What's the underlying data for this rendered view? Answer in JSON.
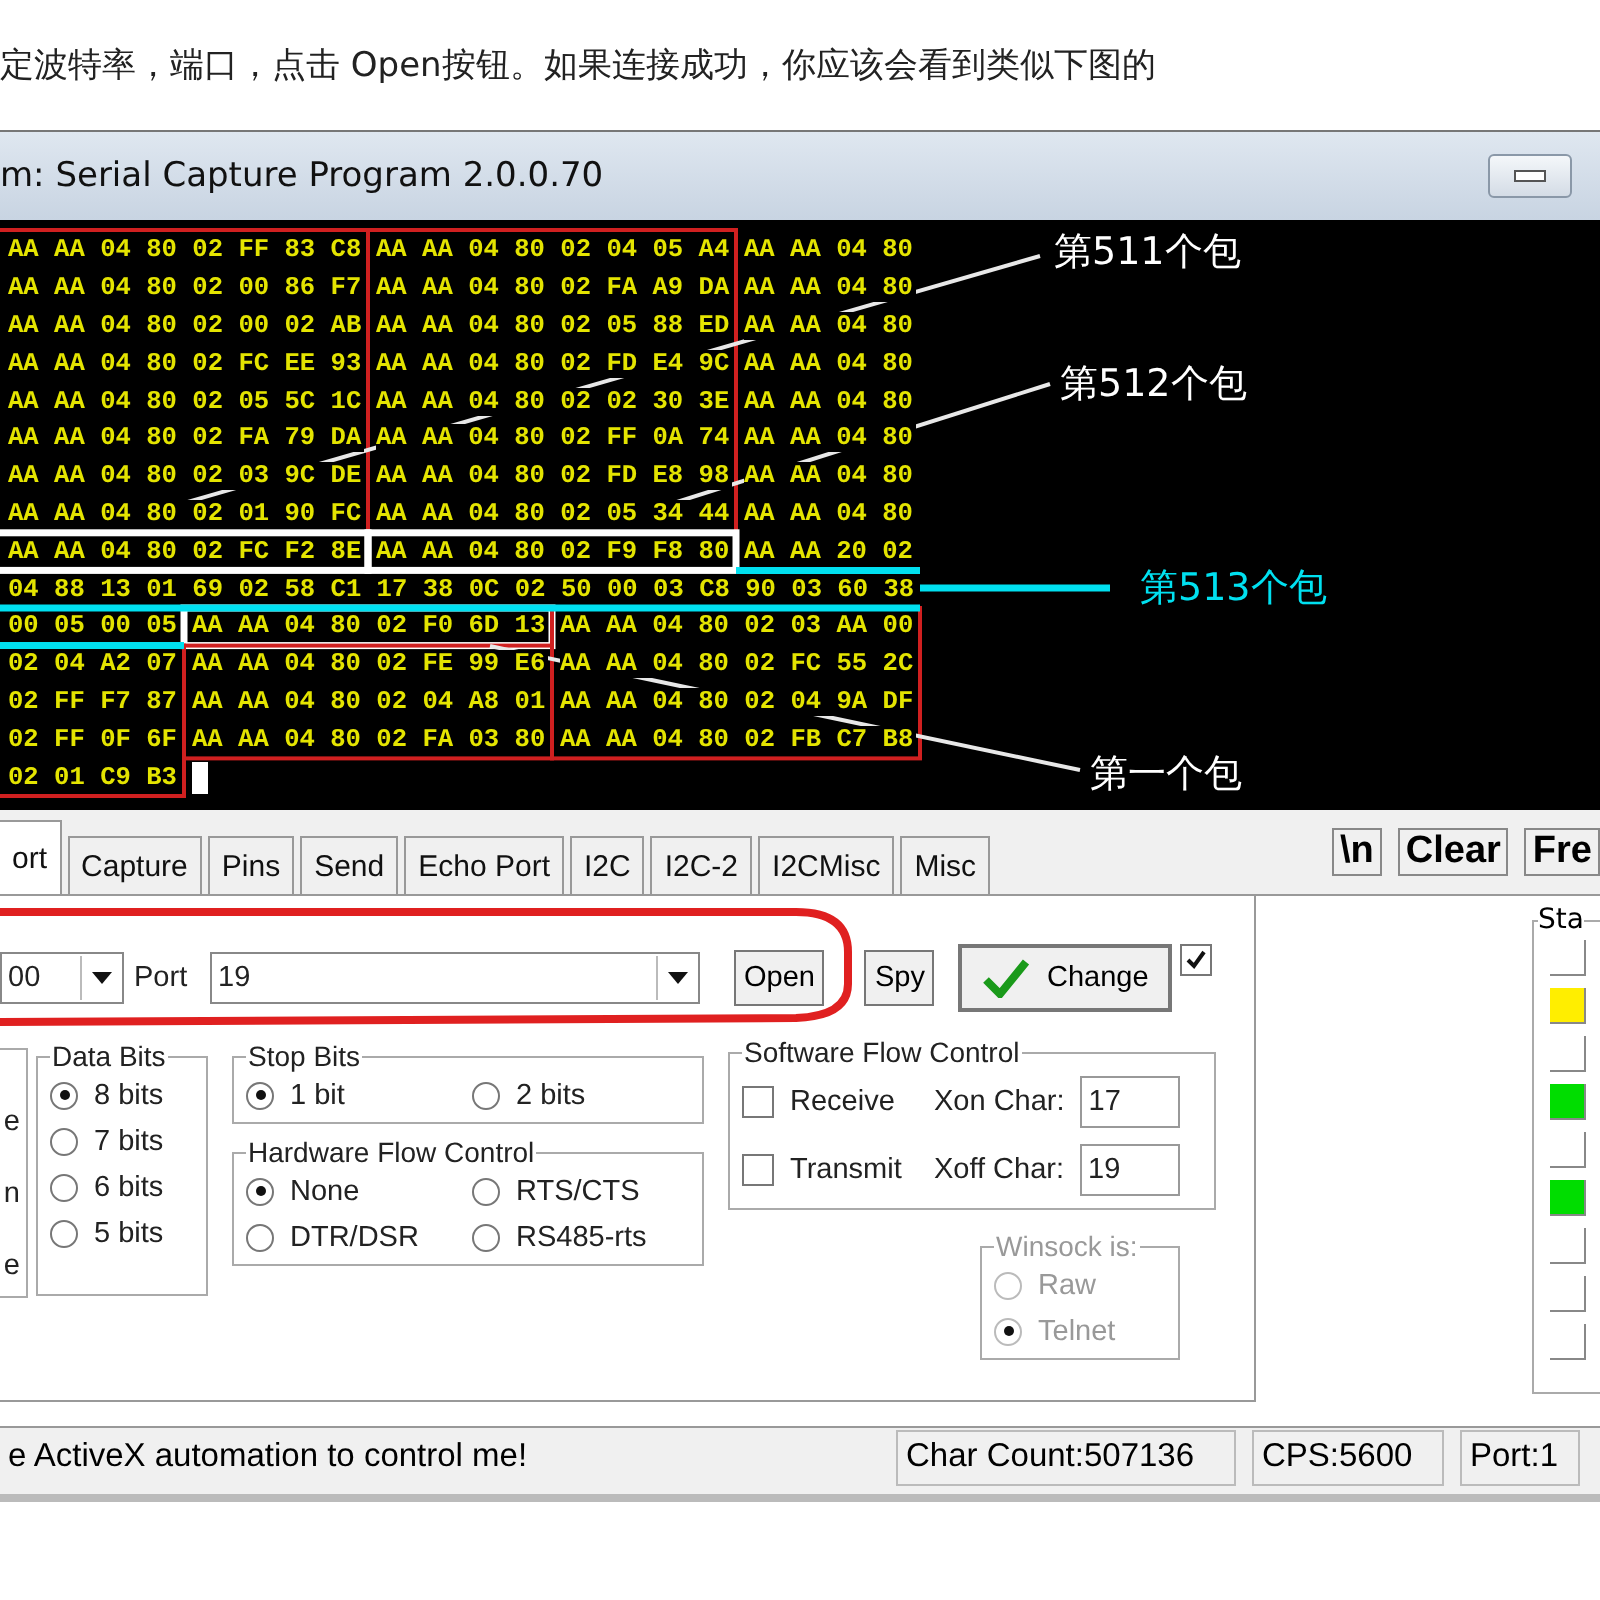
{
  "instruction": "定波特率，端口，点击 Open按钮。如果连接成功，你应该会看到类似下图的",
  "window": {
    "title": "m: Serial Capture Program 2.0.0.70"
  },
  "terminal": {
    "rows": [
      [
        "AA AA 04 80 02 FF 83 C8",
        "AA AA 04 80 02 04 05 A4",
        "AA AA 04 80"
      ],
      [
        "AA AA 04 80 02 00 86 F7",
        "AA AA 04 80 02 FA A9 DA",
        "AA AA 04 80"
      ],
      [
        "AA AA 04 80 02 00 02 AB",
        "AA AA 04 80 02 05 88 ED",
        "AA AA 04 80"
      ],
      [
        "AA AA 04 80 02 FC EE 93",
        "AA AA 04 80 02 FD E4 9C",
        "AA AA 04 80"
      ],
      [
        "AA AA 04 80 02 05 5C 1C",
        "AA AA 04 80 02 02 30 3E",
        "AA AA 04 80"
      ],
      [
        "AA AA 04 80 02 FA 79 DA",
        "AA AA 04 80 02 FF 0A 74",
        "AA AA 04 80"
      ],
      [
        "AA AA 04 80 02 03 9C DE",
        "AA AA 04 80 02 FD E8 98",
        "AA AA 04 80"
      ],
      [
        "AA AA 04 80 02 01 90 FC",
        "AA AA 04 80 02 05 34 44",
        "AA AA 04 80"
      ],
      [
        "AA AA 04 80 02 FC F2 8E",
        "AA AA 04 80 02 F9 F8 80",
        "AA AA 20 02"
      ],
      [
        "04 88 13 01 69 02 58 C1 17 38 0C 02 50 00 03 C8 90 03 60 38"
      ],
      [
        "00 05 00 05",
        "AA AA 04 80 02 F0 6D 13",
        "AA AA 04 80 02 03 AA 00"
      ],
      [
        "02 04 A2 07",
        "AA AA 04 80 02 FE 99 E6",
        "AA AA 04 80 02 FC 55 2C"
      ],
      [
        "02 FF F7 87",
        "AA AA 04 80 02 04 A8 01",
        "AA AA 04 80 02 04 9A DF"
      ],
      [
        "02 FF 0F 6F",
        "AA AA 04 80 02 FA 03 80",
        "AA AA 04 80 02 FB C7 B8"
      ],
      [
        "02 01 C9 B3"
      ]
    ]
  },
  "annotations": [
    {
      "text": "第511个包",
      "color": "#ffffff"
    },
    {
      "text": "第512个包",
      "color": "#ffffff"
    },
    {
      "text": "第513个包",
      "color": "#00e0f0"
    },
    {
      "text": "第一个包",
      "color": "#ffffff"
    }
  ],
  "tabs": [
    {
      "label": "ort",
      "selected": true
    },
    {
      "label": "Capture",
      "selected": false
    },
    {
      "label": "Pins",
      "selected": false
    },
    {
      "label": "Send",
      "selected": false
    },
    {
      "label": "Echo Port",
      "selected": false
    },
    {
      "label": "I2C",
      "selected": false
    },
    {
      "label": "I2C-2",
      "selected": false
    },
    {
      "label": "I2CMisc",
      "selected": false
    },
    {
      "label": "Misc",
      "selected": false
    }
  ],
  "toolbar_buttons": [
    "\\n",
    "Clear",
    "Fre"
  ],
  "port_row": {
    "baud": "00",
    "port_label": "Port",
    "port": "19",
    "open": "Open",
    "spy": "Spy",
    "change": "Change",
    "checked": true
  },
  "left_group": {
    "options": [
      "e",
      "n",
      "e"
    ]
  },
  "data_bits": {
    "title": "Data Bits",
    "options": [
      {
        "label": "8 bits",
        "selected": true
      },
      {
        "label": "7 bits",
        "selected": false
      },
      {
        "label": "6 bits",
        "selected": false
      },
      {
        "label": "5 bits",
        "selected": false
      }
    ]
  },
  "stop_bits": {
    "title": "Stop Bits",
    "options": [
      {
        "label": "1 bit",
        "selected": true
      },
      {
        "label": "2 bits",
        "selected": false
      }
    ]
  },
  "hardware_flow": {
    "title": "Hardware Flow Control",
    "options": [
      {
        "label": "None",
        "selected": true
      },
      {
        "label": "RTS/CTS",
        "selected": false
      },
      {
        "label": "DTR/DSR",
        "selected": false
      },
      {
        "label": "RS485-rts",
        "selected": false
      }
    ]
  },
  "software_flow": {
    "title": "Software Flow Control",
    "rows": [
      {
        "label": "Receive",
        "checked": false,
        "char_label": "Xon Char:",
        "value": "17"
      },
      {
        "label": "Transmit",
        "checked": false,
        "char_label": "Xoff Char:",
        "value": "19"
      }
    ]
  },
  "winsock": {
    "title": "Winsock is:",
    "disabled": true,
    "options": [
      {
        "label": "Raw",
        "selected": false
      },
      {
        "label": "Telnet",
        "selected": true
      }
    ]
  },
  "status_panel": {
    "title": "Sta",
    "leds": [
      {
        "lit": false
      },
      {
        "lit": true,
        "color": "#ffee00"
      },
      {
        "lit": false
      },
      {
        "lit": true,
        "color": "#00dd00"
      },
      {
        "lit": false
      },
      {
        "lit": true,
        "color": "#00dd00"
      },
      {
        "lit": false
      },
      {
        "lit": false
      },
      {
        "lit": false
      }
    ]
  },
  "status_bar": [
    "e ActiveX automation to control me!",
    "Char Count:507136",
    "CPS:5600",
    "Port:1"
  ]
}
